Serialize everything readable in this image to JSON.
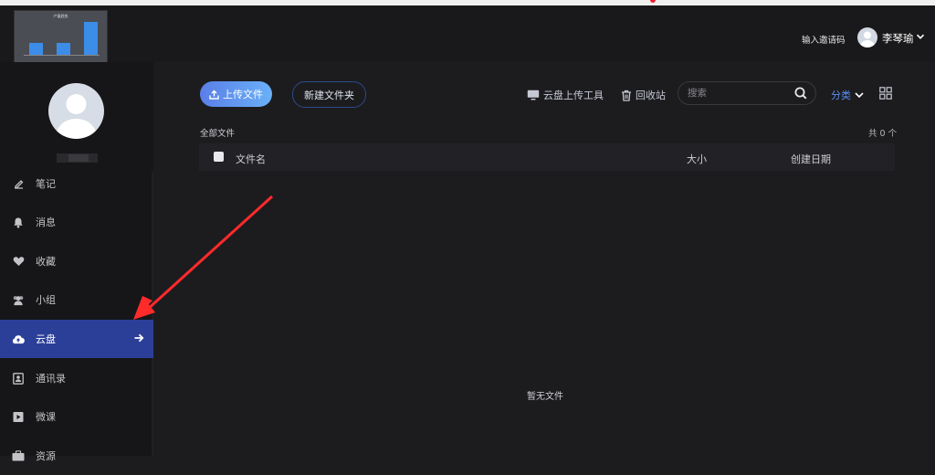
{
  "header": {
    "thumbnail_title": "产量趋势",
    "thumbnail_chart_values": [
      22,
      22,
      62
    ],
    "invite_label": "输入邀请码",
    "username": "李琴瑜",
    "icons": [
      "avatar-icon",
      "chevron-down-icon"
    ]
  },
  "sidebar": {
    "items": [
      {
        "label": "笔记",
        "icon": "note-icon"
      },
      {
        "label": "消息",
        "icon": "bell-icon"
      },
      {
        "label": "收藏",
        "icon": "heart-icon"
      },
      {
        "label": "小组",
        "icon": "group-icon"
      },
      {
        "label": "云盘",
        "icon": "cloud-upload-icon",
        "active": true
      },
      {
        "label": "通讯录",
        "icon": "contacts-icon"
      },
      {
        "label": "微课",
        "icon": "video-icon"
      },
      {
        "label": "资源",
        "icon": "briefcase-icon"
      }
    ]
  },
  "toolbar": {
    "upload_label": "上传文件",
    "new_folder_label": "新建文件夹",
    "uploader_tool_label": "云盘上传工具",
    "recycle_label": "回收站",
    "search_placeholder": "搜索",
    "category_label": "分类",
    "accent_color": "#5d8ff0"
  },
  "files": {
    "breadcrumb": "全部文件",
    "count_text": "共 0 个",
    "columns": {
      "name": "文件名",
      "size": "大小",
      "created": "创建日期"
    },
    "empty_text": "暂无文件",
    "rows": []
  }
}
